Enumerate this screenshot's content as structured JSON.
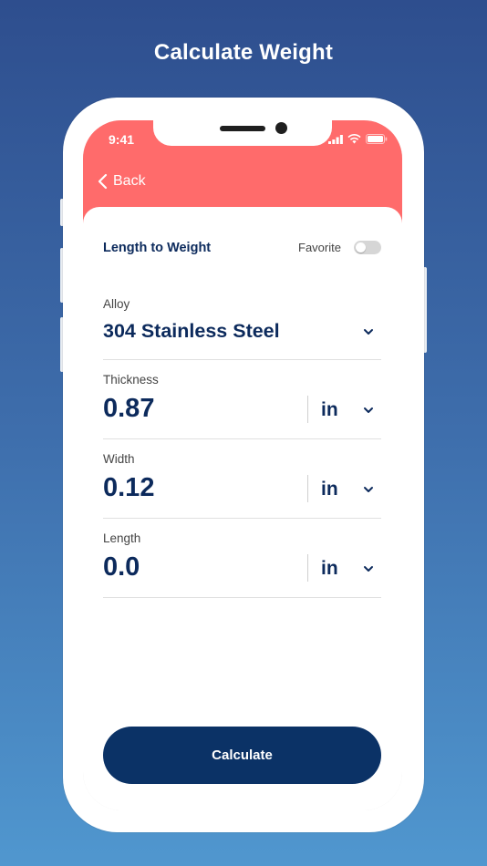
{
  "page": {
    "headline": "Calculate Weight"
  },
  "status_bar": {
    "time": "9:41",
    "icons": [
      "signal-icon",
      "wifi-icon",
      "battery-icon"
    ]
  },
  "nav": {
    "back_label": "Back"
  },
  "card": {
    "title": "Length to Weight",
    "favorite_label": "Favorite",
    "favorite_on": false
  },
  "fields": {
    "alloy": {
      "label": "Alloy",
      "value": "304 Stainless Steel"
    },
    "thickness": {
      "label": "Thickness",
      "value": "0.87",
      "unit": "in"
    },
    "width": {
      "label": "Width",
      "value": "0.12",
      "unit": "in"
    },
    "length": {
      "label": "Length",
      "value": "0.0",
      "unit": "in"
    }
  },
  "actions": {
    "calculate_label": "Calculate"
  },
  "colors": {
    "header": "#ff6b6b",
    "primary": "#0b3266",
    "text_dark": "#0c2a5c",
    "background_top": "#2e4e8e",
    "background_bottom": "#5097cf"
  }
}
